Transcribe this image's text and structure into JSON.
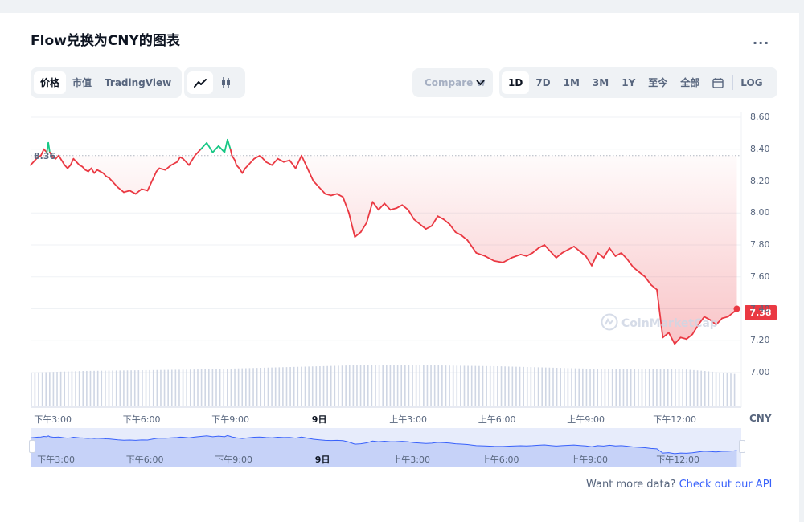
{
  "title": "Flow兑换为CNY的图表",
  "more_label": "...",
  "tabs": [
    {
      "label": "价格",
      "active": true
    },
    {
      "label": "市值",
      "active": false
    },
    {
      "label": "TradingView",
      "active": false
    }
  ],
  "chart_type_icons": [
    "line-chart-icon",
    "candlestick-icon"
  ],
  "compare_label": "Compare w",
  "ranges": [
    {
      "label": "1D",
      "active": true
    },
    {
      "label": "7D",
      "active": false
    },
    {
      "label": "1M",
      "active": false
    },
    {
      "label": "3M",
      "active": false
    },
    {
      "label": "1Y",
      "active": false
    },
    {
      "label": "至今",
      "active": false
    },
    {
      "label": "全部",
      "active": false
    }
  ],
  "log_label": "LOG",
  "currency_label": "CNY",
  "current_price": "7.38",
  "reference_price": "8.36",
  "watermark": "CoinMarketCap",
  "footer": {
    "prefix": "Want more data?",
    "link": "Check out our API"
  },
  "colors": {
    "up": "#16c784",
    "down": "#ea3943",
    "volume": "#cfd6e4",
    "navigator": "#3861fb"
  },
  "chart_data": {
    "type": "line",
    "title": "Flow兑换为CNY的图表",
    "ylabel": "CNY",
    "ylim": [
      6.8,
      8.6
    ],
    "yticks": [
      "8.60",
      "8.40",
      "8.20",
      "8.00",
      "7.80",
      "7.60",
      "7.40",
      "7.20",
      "7.00"
    ],
    "xtick_labels": [
      "下午3:00",
      "下午6:00",
      "下午9:00",
      "9日",
      "上午3:00",
      "上午6:00",
      "上午9:00",
      "下午12:00"
    ],
    "xtick_positions_hours": [
      0,
      3,
      6,
      9,
      12,
      15,
      18,
      21
    ],
    "xlim_hours": [
      -0.75,
      23.25
    ],
    "reference_line": 8.36,
    "series": [
      {
        "x_hours": [
          -0.75,
          -0.6,
          -0.5,
          -0.4,
          -0.3,
          -0.2,
          -0.15,
          -0.1,
          0.0,
          0.1,
          0.2,
          0.3,
          0.4,
          0.5,
          0.6,
          0.7,
          0.8,
          0.9,
          1.0,
          1.1,
          1.2,
          1.3,
          1.4,
          1.5,
          1.6,
          1.7,
          1.8,
          1.9,
          2.0,
          2.2,
          2.4,
          2.6,
          2.8,
          3.0,
          3.2,
          3.4,
          3.5,
          3.6,
          3.8,
          4.0,
          4.2,
          4.3,
          4.4,
          4.6,
          4.8,
          5.0,
          5.2,
          5.4,
          5.6,
          5.8,
          5.9,
          6.0,
          6.05,
          6.15,
          6.2,
          6.3,
          6.4,
          6.5,
          6.6,
          6.8,
          7.0,
          7.2,
          7.4,
          7.6,
          7.8,
          8.0,
          8.2,
          8.4,
          8.6,
          8.8,
          9.0,
          9.2,
          9.4,
          9.6,
          9.8,
          10.0,
          10.2,
          10.4,
          10.6,
          10.8,
          11.0,
          11.2,
          11.4,
          11.6,
          11.8,
          12.0,
          12.2,
          12.4,
          12.6,
          12.8,
          13.0,
          13.2,
          13.4,
          13.6,
          13.8,
          14.0,
          14.3,
          14.6,
          14.9,
          15.2,
          15.5,
          15.8,
          16.0,
          16.2,
          16.4,
          16.6,
          16.8,
          17.0,
          17.2,
          17.4,
          17.6,
          17.8,
          18.0,
          18.2,
          18.4,
          18.6,
          18.8,
          19.0,
          19.2,
          19.4,
          19.6,
          19.8,
          20.0,
          20.2,
          20.4,
          20.6,
          20.8,
          21.0,
          21.2,
          21.4,
          21.6,
          21.8,
          22.0,
          22.2,
          22.4,
          22.6,
          22.8,
          23.0,
          23.1
        ],
        "y": [
          8.3,
          8.33,
          8.35,
          8.36,
          8.4,
          8.38,
          8.44,
          8.38,
          8.35,
          8.34,
          8.36,
          8.33,
          8.3,
          8.28,
          8.3,
          8.34,
          8.32,
          8.3,
          8.29,
          8.27,
          8.26,
          8.28,
          8.25,
          8.27,
          8.26,
          8.25,
          8.23,
          8.22,
          8.2,
          8.16,
          8.13,
          8.14,
          8.12,
          8.15,
          8.14,
          8.22,
          8.26,
          8.28,
          8.27,
          8.3,
          8.32,
          8.35,
          8.34,
          8.3,
          8.36,
          8.4,
          8.44,
          8.38,
          8.42,
          8.38,
          8.46,
          8.4,
          8.36,
          8.33,
          8.3,
          8.28,
          8.25,
          8.28,
          8.3,
          8.34,
          8.36,
          8.32,
          8.3,
          8.34,
          8.32,
          8.33,
          8.28,
          8.36,
          8.28,
          8.2,
          8.16,
          8.12,
          8.11,
          8.12,
          8.1,
          8.0,
          7.85,
          7.88,
          7.94,
          8.07,
          8.02,
          8.06,
          8.02,
          8.03,
          8.05,
          8.02,
          7.96,
          7.93,
          7.9,
          7.92,
          7.98,
          7.96,
          7.93,
          7.88,
          7.86,
          7.83,
          7.75,
          7.73,
          7.7,
          7.69,
          7.72,
          7.74,
          7.73,
          7.75,
          7.78,
          7.8,
          7.76,
          7.72,
          7.75,
          7.77,
          7.79,
          7.76,
          7.73,
          7.67,
          7.75,
          7.72,
          7.78,
          7.73,
          7.75,
          7.71,
          7.66,
          7.63,
          7.6,
          7.55,
          7.52,
          7.22,
          7.25,
          7.18,
          7.22,
          7.21,
          7.24,
          7.3,
          7.35,
          7.33,
          7.3,
          7.34,
          7.35,
          7.38,
          7.4,
          7.42,
          7.38
        ]
      }
    ],
    "volume_relative": {
      "x_hours": [
        -0.75,
        1.0,
        3.0,
        5.0,
        7.0,
        9.0,
        11.0,
        13.0,
        15.0,
        17.0,
        19.0,
        21.0,
        22.0,
        23.1
      ],
      "v": [
        0.42,
        0.44,
        0.45,
        0.46,
        0.48,
        0.5,
        0.52,
        0.51,
        0.5,
        0.48,
        0.46,
        0.47,
        0.44,
        0.4
      ]
    },
    "navigator": {
      "xtick_labels": [
        "下午3:00",
        "下午6:00",
        "下午9:00",
        "9日",
        "上午3:00",
        "上午6:00",
        "上午9:00",
        "下午12:00"
      ]
    }
  }
}
